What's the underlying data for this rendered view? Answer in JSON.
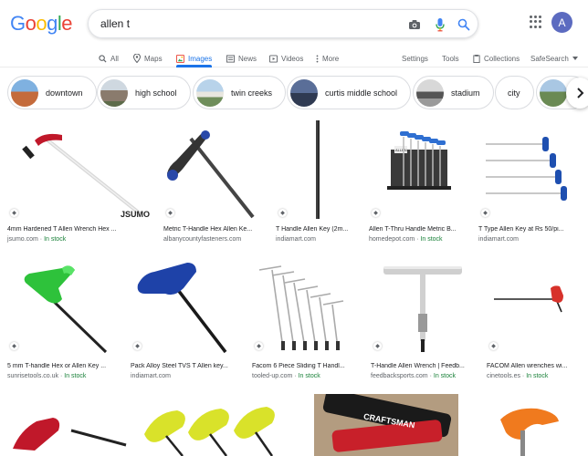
{
  "logo": {
    "letters": [
      "G",
      "o",
      "o",
      "g",
      "l",
      "e"
    ],
    "colors": [
      "#4285f4",
      "#ea4335",
      "#fbbc05",
      "#4285f4",
      "#34a853",
      "#ea4335"
    ]
  },
  "search": {
    "query": "allen t"
  },
  "icons": {
    "camera": "camera-icon",
    "mic": "mic-icon",
    "search": "search-icon",
    "apps": "apps-icon"
  },
  "account": {
    "initial": "A",
    "color": "#5c6bc0"
  },
  "tabs": [
    {
      "label": "All",
      "icon": "search-icon"
    },
    {
      "label": "Maps",
      "icon": "map-pin-icon"
    },
    {
      "label": "Images",
      "icon": "image-icon",
      "active": true
    },
    {
      "label": "News",
      "icon": "news-icon"
    },
    {
      "label": "Videos",
      "icon": "video-icon"
    },
    {
      "label": "More",
      "icon": "more-icon"
    }
  ],
  "tools": {
    "settings": "Settings",
    "tools": "Tools",
    "collections": "Collections",
    "safesearch": "SafeSearch"
  },
  "chips": [
    {
      "label": "downtown",
      "color": "#c46b3c"
    },
    {
      "label": "high school",
      "color": "#8a7b6d"
    },
    {
      "label": "twin creeks",
      "color": "#6f8e5b"
    },
    {
      "label": "curtis middle school",
      "color": "#4d5a78"
    },
    {
      "label": "stadium",
      "color": "#7c7c7c"
    },
    {
      "label": "city",
      "color": "#ffffff"
    },
    {
      "label": "",
      "color": "#6a8a54"
    }
  ],
  "results": [
    {
      "caption": "4mm Hardened T Allen Wrench Hex ...",
      "source": "jsumo.com",
      "stock": "In stock"
    },
    {
      "caption": "Metric T-Handle Hex Allen Ke...",
      "source": "albanycountyfasteners.com",
      "stock": ""
    },
    {
      "caption": "T Handle Allen Key (2m...",
      "source": "indiamart.com",
      "stock": ""
    },
    {
      "caption": "Allen T-Thru Handle Metric B...",
      "source": "homedepot.com",
      "stock": "In stock"
    },
    {
      "caption": "T Type Allen Key at Rs 50/pi...",
      "source": "indiamart.com",
      "stock": ""
    },
    {
      "caption": "5 mm T-handle Hex or Allen Key ...",
      "source": "sunrisetools.co.uk",
      "stock": "In stock"
    },
    {
      "caption": "Pack Alloy Steel TVS T Allen key...",
      "source": "indiamart.com",
      "stock": ""
    },
    {
      "caption": "Facom 6 Piece Sliding T Handl...",
      "source": "tooled-up.com",
      "stock": "In stock"
    },
    {
      "caption": "T-Handle Allen Wrench | Feedb...",
      "source": "feedbacksports.com",
      "stock": "In stock"
    },
    {
      "caption": "FACOM Allen wrenches wi...",
      "source": "cinetools.es",
      "stock": "In stock"
    }
  ],
  "image_text": {
    "jsumo": "JSUMO",
    "craftsman": "CRAFTSMAN",
    "homedepot_label": "ALLEN"
  }
}
